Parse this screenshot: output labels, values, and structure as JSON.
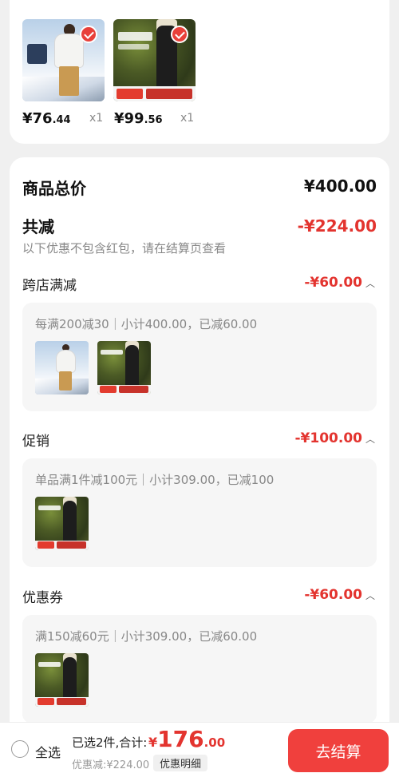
{
  "items": [
    {
      "price_int": "¥76",
      "price_dec": ".44",
      "qty": "x1",
      "image": "white-shirt-product-photo"
    },
    {
      "price_int": "¥99",
      "price_dec": ".56",
      "qty": "x1",
      "image": "black-pants-product-photo"
    }
  ],
  "summary": {
    "total_label": "商品总价",
    "total_value": "¥400.00",
    "reduce_label": "共减",
    "reduce_value": "-¥224.00",
    "note": "以下优惠不包含红包，请在结算页查看"
  },
  "sections": [
    {
      "title": "跨店满减",
      "value": "-¥60.00",
      "rule": "每满200减30｜小计400.00，已减60.00"
    },
    {
      "title": "促销",
      "value": "-¥100.00",
      "rule": "单品满1件减100元｜小计309.00，已减100"
    },
    {
      "title": "优惠券",
      "value": "-¥60.00",
      "rule": "满150减60元｜小计309.00，已减60.00"
    }
  ],
  "bottom": {
    "select_all": "全选",
    "selected_text": "已选2件,合计:",
    "total_symbol": "¥",
    "total_int": "176",
    "total_dec": ".00",
    "discount": "优惠减:¥224.00",
    "detail_button": "优惠明细",
    "checkout_button": "去结算"
  },
  "colors": {
    "accent": "#e3342f",
    "checkout": "#f0403d",
    "background": "#f0f0f0"
  }
}
